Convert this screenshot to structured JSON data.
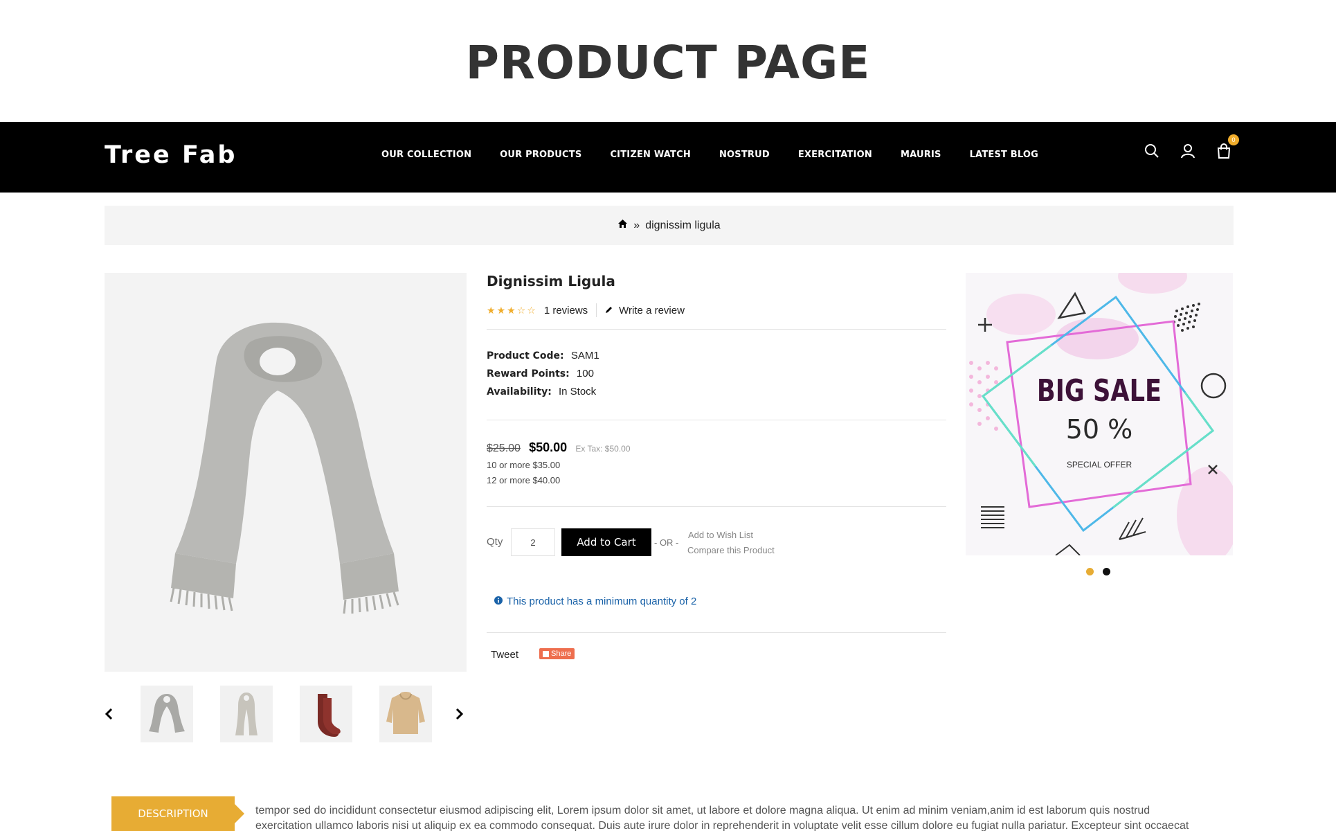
{
  "page_heading": "PRODUCT PAGE",
  "nav": {
    "logo": "Tree Fab",
    "menu": [
      "OUR COLLECTION",
      "OUR PRODUCTS",
      "CITIZEN WATCH",
      "NOSTRUD",
      "EXERCITATION",
      "MAURIS",
      "LATEST BLOG"
    ],
    "cart_count": "0"
  },
  "breadcrumb": {
    "separator": "»",
    "current": "dignissim ligula"
  },
  "product": {
    "title": "Dignissim Ligula",
    "rating": 3,
    "rating_max": 5,
    "reviews": "1 reviews",
    "write_review": "Write a review",
    "code_label": "Product Code:",
    "code": "SAM1",
    "points_label": "Reward Points:",
    "points": "100",
    "availability_label": "Availability:",
    "availability": "In Stock",
    "price_old": "$25.00",
    "price_new": "$50.00",
    "ex_tax": "Ex Tax: $50.00",
    "discount_1": "10 or more $35.00",
    "discount_2": "12 or more $40.00",
    "qty_label": "Qty",
    "qty_value": "2",
    "add_to_cart": "Add to Cart",
    "or": "- OR -",
    "wish_list": "Add to Wish List",
    "compare": "Compare this Product",
    "min_qty": "This product has a minimum quantity of 2",
    "tweet": "Tweet",
    "share": "Share"
  },
  "thumbnails": [
    "scarf-thumbnail",
    "scarf-thumbnail",
    "socks-thumbnail",
    "hoodie-thumbnail"
  ],
  "banner": {
    "title": "BIG SALE",
    "percent": "50 %",
    "subtitle": "SPECIAL OFFER",
    "slides": 2,
    "active_slide": 1
  },
  "colors": {
    "accent": "#e7ac34",
    "nav_bg": "#000000",
    "star": "#f0ad2c",
    "link_blue": "#1a62a8"
  },
  "description": {
    "tab": "DESCRIPTION",
    "line1": "tempor sed do incididunt consectetur eiusmod adipiscing elit, Lorem ipsum dolor sit amet, ut labore et dolore magna aliqua. Ut enim ad minim veniam,anim id est laborum quis nostrud",
    "line2": "exercitation ullamco laboris nisi ut aliquip ex ea commodo consequat. Duis aute irure dolor in reprehenderit in voluptate velit esse cillum dolore eu fugiat nulla pariatur. Excepteur sint occaecat"
  }
}
